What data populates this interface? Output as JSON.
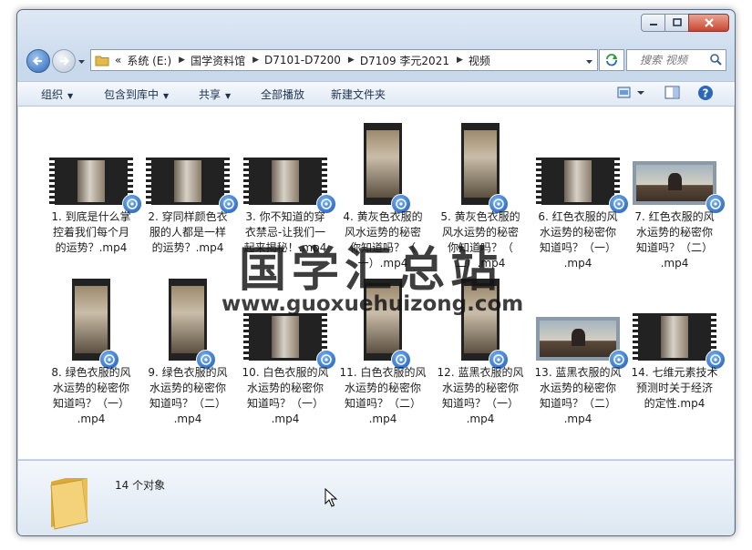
{
  "window": {
    "caption_buttons": [
      "minimize",
      "maximize",
      "close"
    ]
  },
  "address": {
    "overflow": "«",
    "crumbs": [
      "系统 (E:)",
      "国学资料馆",
      "D7101-D7200",
      "D7109 李元2021",
      "视频"
    ]
  },
  "search": {
    "placeholder": "搜索 视频"
  },
  "toolbar": {
    "organize": "组织",
    "include_library": "包含到库中",
    "share": "共享",
    "play_all": "全部播放",
    "new_folder": "新建文件夹"
  },
  "files": [
    {
      "label": "1. 到底是什么掌控着我们每个月的运势？.mp4",
      "lines": [
        "1. 到底是什么掌",
        "控着我们每个月",
        "的运势？.mp4"
      ],
      "thumb": "wide"
    },
    {
      "label": "2. 穿同样颜色衣服的人都是一样的运势？.mp4",
      "lines": [
        "2. 穿同样颜色衣",
        "服的人都是一样",
        "的运势？.mp4"
      ],
      "thumb": "wide"
    },
    {
      "label": "3. 你不知道的穿衣禁忌-让我们一起来揭秘！.mp4",
      "lines": [
        "3. 你不知道的穿",
        "衣禁忌-让我们一",
        "起来揭秘！.mp4"
      ],
      "thumb": "wide"
    },
    {
      "label": "4. 黄灰色衣服的风水运势的秘密你知道吗？（一）.mp4",
      "lines": [
        "4. 黄灰色衣服的",
        "风水运势的秘密",
        "你知道吗？（",
        "一）.mp4"
      ],
      "thumb": "tall"
    },
    {
      "label": "5. 黄灰色衣服的风水运势的秘密你知道吗？（二）.mp4",
      "lines": [
        "5. 黄灰色衣服的",
        "风水运势的秘密",
        "你知道吗？（",
        "二）.mp4"
      ],
      "thumb": "tall"
    },
    {
      "label": "6. 红色衣服的风水运势的秘密你知道吗？（一）.mp4",
      "lines": [
        "6. 红色衣服的风",
        "水运势的秘密你",
        "知道吗？（一）",
        ".mp4"
      ],
      "thumb": "wide"
    },
    {
      "label": "7. 红色衣服的风水运势的秘密你知道吗？（二）.mp4",
      "lines": [
        "7. 红色衣服的风",
        "水运势的秘密你",
        "知道吗？（二）",
        ".mp4"
      ],
      "thumb": "full"
    },
    {
      "label": "8. 绿色衣服的风水运势的秘密你知道吗？（一）.mp4",
      "lines": [
        "8. 绿色衣服的风",
        "水运势的秘密你",
        "知道吗？（一）",
        ".mp4"
      ],
      "thumb": "tall"
    },
    {
      "label": "9. 绿色衣服的风水运势的秘密你知道吗？（二）.mp4",
      "lines": [
        "9. 绿色衣服的风",
        "水运势的秘密你",
        "知道吗？（二）",
        ".mp4"
      ],
      "thumb": "tall"
    },
    {
      "label": "10. 白色衣服的风水运势的秘密你知道吗？（一）.mp4",
      "lines": [
        "10. 白色衣服的风",
        "水运势的秘密你",
        "知道吗？（一）",
        ".mp4"
      ],
      "thumb": "wide"
    },
    {
      "label": "11. 白色衣服的风水运势的秘密你知道吗？（二）.mp4",
      "lines": [
        "11. 白色衣服的风",
        "水运势的秘密你",
        "知道吗？（二）",
        ".mp4"
      ],
      "thumb": "tall"
    },
    {
      "label": "12. 蓝黑衣服的风水运势的秘密你知道吗？（一）.mp4",
      "lines": [
        "12. 蓝黑衣服的风",
        "水运势的秘密你",
        "知道吗？（一）",
        ".mp4"
      ],
      "thumb": "tall"
    },
    {
      "label": "13. 蓝黑衣服的风水运势的秘密你知道吗？（二）.mp4",
      "lines": [
        "13. 蓝黑衣服的风",
        "水运势的秘密你",
        "知道吗？（二）",
        ".mp4"
      ],
      "thumb": "full"
    },
    {
      "label": "14. 七维元素技术预测时关于经济的定性.mp4",
      "lines": [
        "14. 七维元素技术",
        "预测时关于经济",
        "的定性.mp4"
      ],
      "thumb": "wide"
    }
  ],
  "status": {
    "count_text": "14 个对象"
  },
  "watermark": {
    "title": "国学汇总站",
    "url": "www.guoxuehuizong.com"
  },
  "colors": {
    "window_frame": "#c9d9ec",
    "toolbar": "#dfe8f3",
    "badge": "#1a57b5"
  }
}
